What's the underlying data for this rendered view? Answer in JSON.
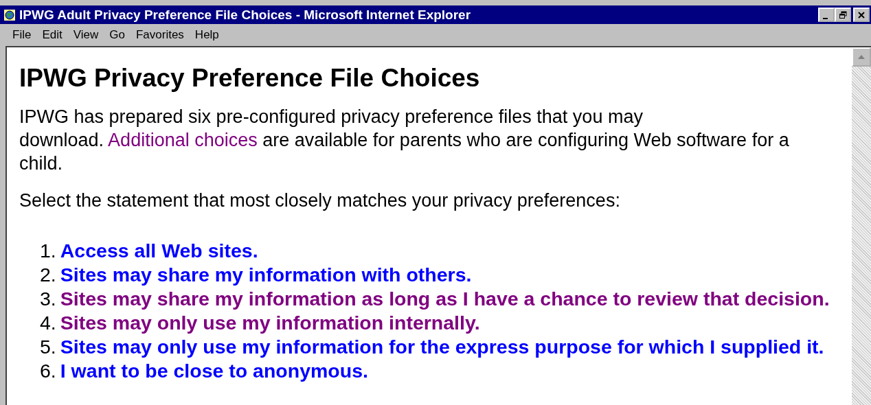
{
  "window": {
    "title": "IPWG Adult Privacy Preference File Choices - Microsoft Internet Explorer"
  },
  "menu": [
    "File",
    "Edit",
    "View",
    "Go",
    "Favorites",
    "Help"
  ],
  "page": {
    "heading": "IPWG Privacy Preference File Choices",
    "intro": [
      {
        "kind": "text",
        "text": "IPWG has prepared six pre-configured privacy preference files that you may "
      },
      {
        "kind": "break"
      },
      {
        "kind": "text",
        "text": "download. "
      },
      {
        "kind": "link",
        "text": "Additional choices",
        "visited": true
      },
      {
        "kind": "text",
        "text": " are available for parents who are configuring Web software for a child."
      }
    ],
    "prompt": "Select the statement that most closely matches your privacy preferences:",
    "choices": [
      {
        "number": "1.",
        "text": "Access all Web sites.",
        "visited": false
      },
      {
        "number": "2.",
        "text": "Sites may share my information with others.",
        "visited": false
      },
      {
        "number": "3.",
        "text": "Sites may share my information as long as I have a chance to review that decision.",
        "visited": true
      },
      {
        "number": "4.",
        "text": "Sites may only use my information internally.",
        "visited": true
      },
      {
        "number": "5.",
        "text": "Sites may only use my information for the express purpose for which I supplied it.",
        "visited": false
      },
      {
        "number": "6.",
        "text": "I want to be close to anonymous.",
        "visited": false
      }
    ]
  }
}
